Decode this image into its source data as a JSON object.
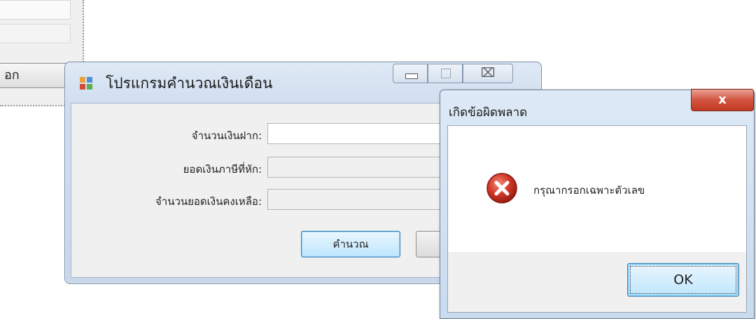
{
  "background_window": {
    "button_label": "อก"
  },
  "main_window": {
    "title": "โปรแกรมคำนวณเงินเดือน",
    "caption_buttons": {
      "close_glyph": "⌧"
    },
    "fields": [
      {
        "label": "จำนวนเงินฝาก:",
        "value": ""
      },
      {
        "label": "ยอดเงินภาษีที่หัก:",
        "value": ""
      },
      {
        "label": "จำนวนยอดเงินคงเหลือ:",
        "value": ""
      }
    ],
    "calculate_button": "คำนวณ"
  },
  "message_box": {
    "title": "เกิดข้อผิดพลาด",
    "close_glyph": "x",
    "message": "กรุณากรอกเฉพาะตัวเลข",
    "ok_button": "OK",
    "icon": "error-icon"
  }
}
